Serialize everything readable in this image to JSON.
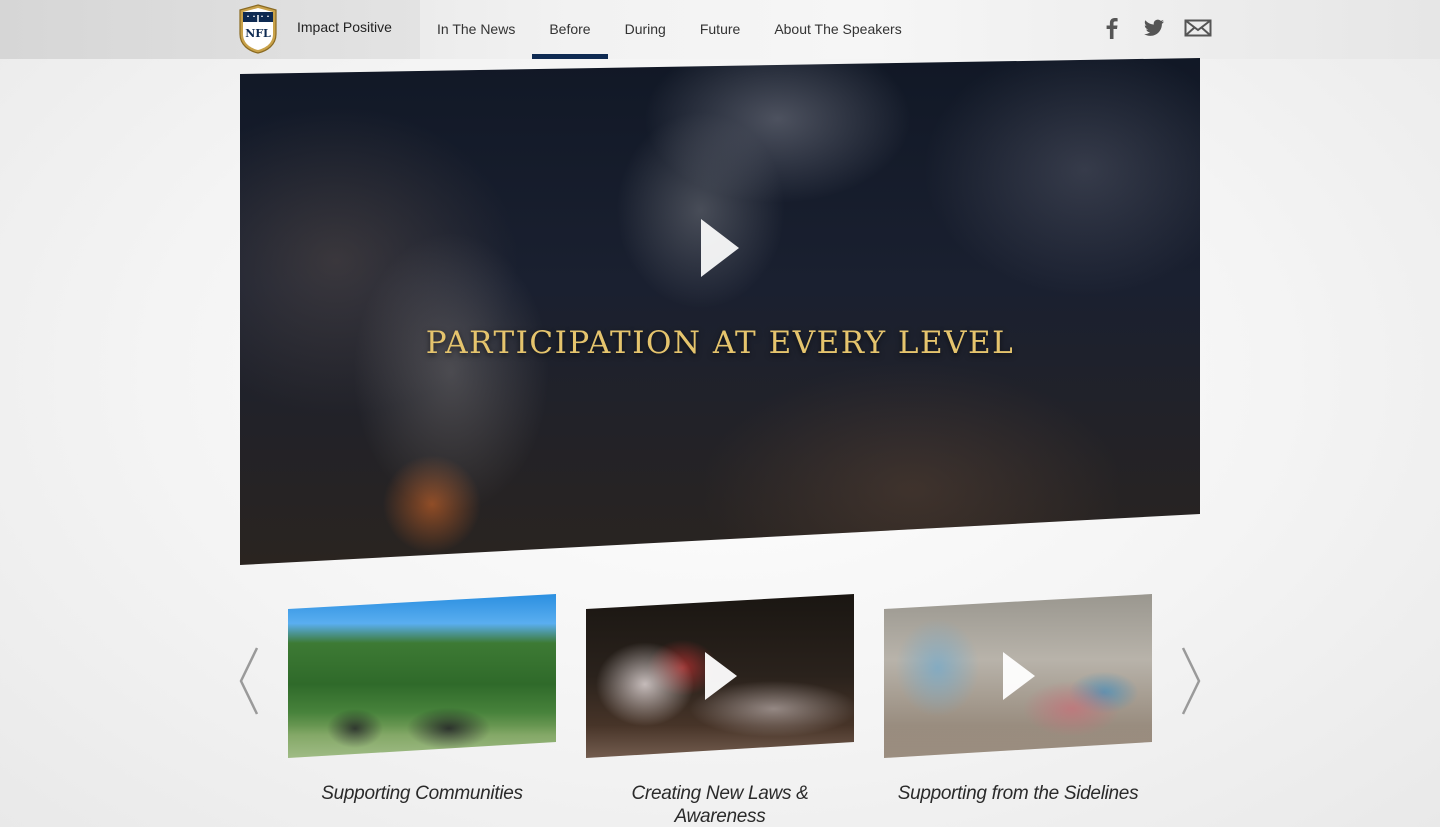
{
  "header": {
    "brand_name": "Impact Positive",
    "logo_text": "NFL",
    "nav": [
      {
        "label": "In The News",
        "active": false
      },
      {
        "label": "Before",
        "active": true
      },
      {
        "label": "During",
        "active": false
      },
      {
        "label": "Future",
        "active": false
      },
      {
        "label": "About The Speakers",
        "active": false
      }
    ],
    "social": [
      "facebook-icon",
      "twitter-icon",
      "email-icon"
    ]
  },
  "hero": {
    "title": "PARTICIPATION AT EVERY LEVEL",
    "title_color": "#e5c46d",
    "play_icon": "play-icon"
  },
  "carousel": {
    "items": [
      {
        "caption": "Supporting Communities",
        "has_play": false
      },
      {
        "caption": "Creating New Laws & Awareness",
        "has_play": true
      },
      {
        "caption": "Supporting from the Sidelines",
        "has_play": true
      }
    ],
    "prev_icon": "chevron-left-icon",
    "next_icon": "chevron-right-icon"
  },
  "colors": {
    "active_underline": "#0e2a52",
    "shield_gold": "#c9a24a"
  }
}
